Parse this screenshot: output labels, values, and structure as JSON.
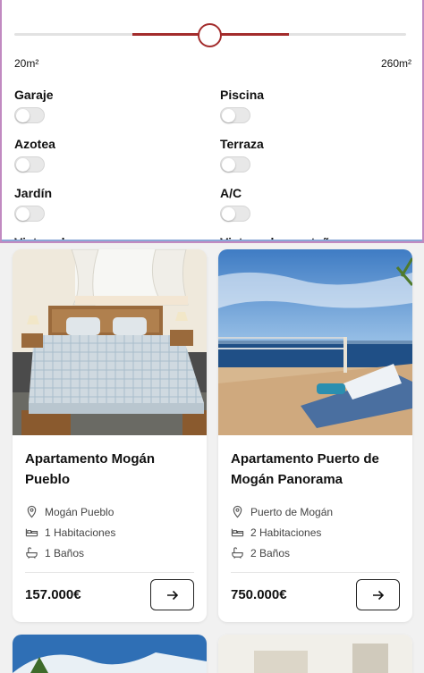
{
  "filters": {
    "size_min_label": "20m²",
    "size_max_label": "260m²",
    "size_slider_position": 0.48,
    "toggles": [
      {
        "label": "Garaje",
        "on": false
      },
      {
        "label": "Piscina",
        "on": false
      },
      {
        "label": "Azotea",
        "on": false
      },
      {
        "label": "Terraza",
        "on": false
      },
      {
        "label": "Jardín",
        "on": false
      },
      {
        "label": "A/C",
        "on": false
      },
      {
        "label": "Vistas al mar",
        "on": false
      },
      {
        "label": "Vistas a la montaña",
        "on": false
      }
    ]
  },
  "listings": [
    {
      "title": "Apartamento Mogán Pueblo",
      "location": "Mogán Pueblo",
      "rooms": "1 Habitaciones",
      "baths": "1 Baños",
      "price": "157.000€"
    },
    {
      "title": "Apartamento Puerto de Mogán Panorama",
      "location": "Puerto de Mogán",
      "rooms": "2 Habitaciones",
      "baths": "2 Baños",
      "price": "750.000€"
    }
  ],
  "colors": {
    "accent": "#a32c2c",
    "panel_border": "#c18ac1"
  },
  "icons": {
    "location": "map-pin-icon",
    "rooms": "bed-icon",
    "baths": "bathtub-icon",
    "detail": "arrow-right-icon"
  }
}
